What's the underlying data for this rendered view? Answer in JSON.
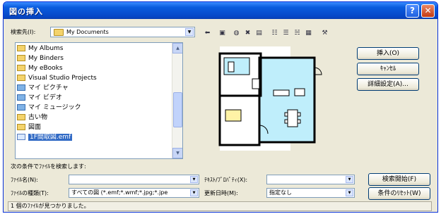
{
  "window": {
    "title": "図の挿入",
    "help_glyph": "?",
    "close_glyph": "✕"
  },
  "lookin": {
    "label": "検索先(I):",
    "value": "My Documents"
  },
  "toolbar_icons": [
    "back-icon",
    "up-folder-icon",
    "search-web-icon",
    "delete-icon",
    "new-folder-icon",
    "views-list-icon",
    "views-details-icon",
    "views-properties-icon",
    "views-preview-icon",
    "tools-icon"
  ],
  "files": [
    {
      "name": "My Albums",
      "icon": "folder"
    },
    {
      "name": "My Binders",
      "icon": "folder"
    },
    {
      "name": "My eBooks",
      "icon": "folder"
    },
    {
      "name": "Visual Studio Projects",
      "icon": "folder"
    },
    {
      "name": "マイ ピクチャ",
      "icon": "media"
    },
    {
      "name": "マイ ビデオ",
      "icon": "media"
    },
    {
      "name": "マイ ミュージック",
      "icon": "media"
    },
    {
      "name": "古い物",
      "icon": "folder"
    },
    {
      "name": "図面",
      "icon": "folder"
    },
    {
      "name": "1F間取図.emf",
      "icon": "doc",
      "selected": true
    }
  ],
  "buttons": {
    "insert": "挿入(O)",
    "cancel": "ｷｬﾝｾﾙ",
    "advanced": "詳細設定(A)...",
    "find_now": "検索開始(F)",
    "new_search": "条件のﾘｾｯﾄ(W)"
  },
  "criteria": {
    "heading": "次の条件でﾌｧｲﾙを検索します:",
    "filename_label": "ﾌｧｲﾙ名(N):",
    "filename_value": "",
    "filetype_label": "ﾌｧｲﾙの種類(T):",
    "filetype_value": "すべての図 (*.emf;*.wmf;*.jpg;*.jpe",
    "text_label": "ﾃｷｽﾄ/ﾌﾟﾛﾊﾟﾃｨ(X):",
    "text_value": "",
    "modified_label": "更新日時(M):",
    "modified_value": "指定なし"
  },
  "status": "1 個のﾌｧｲﾙが見つかりました。",
  "colors": {
    "titlebar": "#0a5ddf",
    "selection": "#316ac5",
    "floor_fill": "#bfeefb"
  }
}
